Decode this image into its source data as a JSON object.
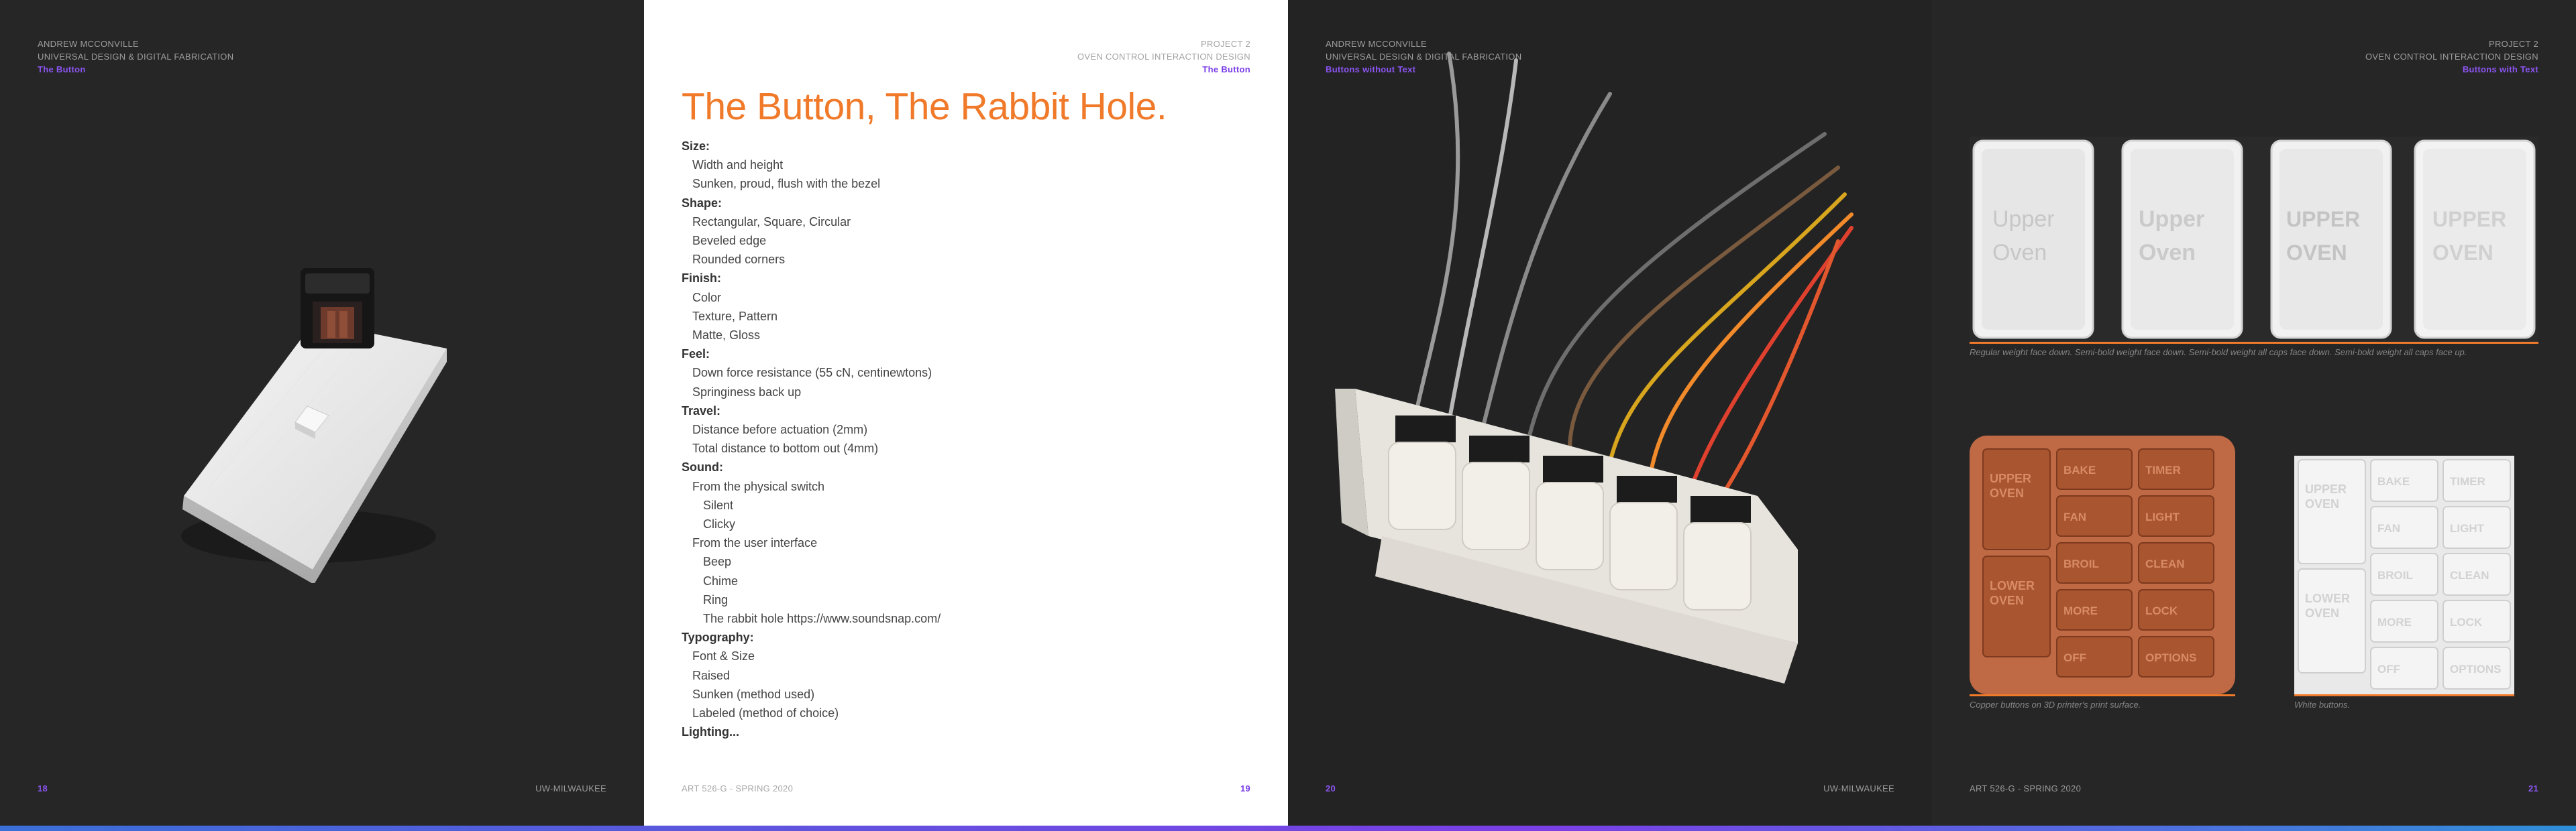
{
  "pages": {
    "p18": {
      "meta": [
        "ANDREW MCCONVILLE",
        "UNIVERSAL DESIGN & DIGITAL FABRICATION"
      ],
      "subtitle": "The Button",
      "page_number": "18",
      "footer": "UW-MILWAUKEE"
    },
    "p19": {
      "meta": [
        "PROJECT 2",
        "OVEN CONTROL INTERACTION DESIGN"
      ],
      "subtitle": "The Button",
      "heading": "The Button, The Rabbit Hole.",
      "outline": [
        {
          "level": 0,
          "text": "Size:"
        },
        {
          "level": 1,
          "text": "Width and height"
        },
        {
          "level": 1,
          "text": "Sunken, proud, flush with the bezel"
        },
        {
          "level": 0,
          "text": "Shape:"
        },
        {
          "level": 1,
          "text": "Rectangular, Square, Circular"
        },
        {
          "level": 1,
          "text": "Beveled edge"
        },
        {
          "level": 1,
          "text": "Rounded corners"
        },
        {
          "level": 0,
          "text": "Finish:"
        },
        {
          "level": 1,
          "text": "Color"
        },
        {
          "level": 1,
          "text": "Texture, Pattern"
        },
        {
          "level": 1,
          "text": "Matte, Gloss"
        },
        {
          "level": 0,
          "text": "Feel:"
        },
        {
          "level": 1,
          "text": "Down force resistance (55 cN, centinewtons)"
        },
        {
          "level": 1,
          "text": "Springiness back up"
        },
        {
          "level": 0,
          "text": "Travel:"
        },
        {
          "level": 1,
          "text": "Distance before actuation (2mm)"
        },
        {
          "level": 1,
          "text": "Total distance to bottom out (4mm)"
        },
        {
          "level": 0,
          "text": "Sound:"
        },
        {
          "level": 1,
          "text": "From the physical switch"
        },
        {
          "level": 2,
          "text": "Silent"
        },
        {
          "level": 2,
          "text": "Clicky"
        },
        {
          "level": 1,
          "text": "From the user interface"
        },
        {
          "level": 2,
          "text": "Beep"
        },
        {
          "level": 2,
          "text": "Chime"
        },
        {
          "level": 2,
          "text": "Ring"
        },
        {
          "level": 2,
          "text": "The rabbit hole https://www.soundsnap.com/"
        },
        {
          "level": 0,
          "text": "Typography:"
        },
        {
          "level": 1,
          "text": "Font & Size"
        },
        {
          "level": 1,
          "text": "Raised"
        },
        {
          "level": 1,
          "text": "Sunken (method used)"
        },
        {
          "level": 1,
          "text": "Labeled (method of choice)"
        },
        {
          "level": 0,
          "text": "Lighting..."
        }
      ],
      "footer": "ART 526-G - SPRING 2020",
      "page_number": "19"
    },
    "p20": {
      "meta": [
        "ANDREW MCCONVILLE",
        "UNIVERSAL DESIGN & DIGITAL FABRICATION"
      ],
      "subtitle": "Buttons without Text",
      "page_number": "20",
      "footer": "UW-MILWAUKEE"
    },
    "p21": {
      "meta": [
        "PROJECT 2",
        "OVEN CONTROL INTERACTION DESIGN"
      ],
      "subtitle": "Buttons with Text",
      "keycaps": [
        {
          "line1": "Upper",
          "line2": "Oven"
        },
        {
          "line1": "Upper",
          "line2": "Oven"
        },
        {
          "line1": "UPPER",
          "line2": "OVEN"
        },
        {
          "line1": "UPPER",
          "line2": "OVEN"
        }
      ],
      "keycap_caption": "Regular weight face down. Semi-bold weight face down. Semi-bold weight all caps face down. Semi-bold weight all caps face up.",
      "panel_labels": {
        "tall": [
          "UPPER OVEN",
          "LOWER OVEN"
        ],
        "grid": [
          "BAKE",
          "TIMER",
          "FAN",
          "LIGHT",
          "BROIL",
          "CLEAN",
          "MORE",
          "LOCK",
          "OFF",
          "OPTIONS"
        ]
      },
      "copper_caption": "Copper buttons on 3D printer's print surface.",
      "white_caption": "White buttons.",
      "footer": "ART 526-G - SPRING 2020",
      "page_number": "21"
    }
  },
  "colors": {
    "accent_orange": "#f07a2a",
    "accent_purple": "#8c55f2",
    "copper": "#b5623a"
  }
}
